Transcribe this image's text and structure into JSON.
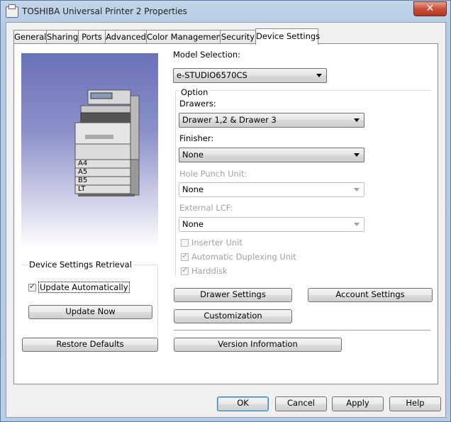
{
  "window": {
    "title": "TOSHIBA Universal Printer 2 Properties",
    "close_label": "✕"
  },
  "tabs": [
    {
      "label": "General"
    },
    {
      "label": "Sharing"
    },
    {
      "label": "Ports"
    },
    {
      "label": "Advanced"
    },
    {
      "label": "Color Management"
    },
    {
      "label": "Security"
    },
    {
      "label": "Device Settings"
    }
  ],
  "preview": {
    "tray_labels": [
      "A4",
      "A5",
      "B5",
      "LT"
    ]
  },
  "model": {
    "label": "Model Selection:",
    "value": "e-STUDIO6570CS"
  },
  "option": {
    "label": "Option",
    "drawers_label": "Drawers:",
    "drawers_value": "Drawer 1,2 & Drawer 3",
    "finisher_label": "Finisher:",
    "finisher_value": "None",
    "hole_punch_label": "Hole Punch Unit:",
    "hole_punch_value": "None",
    "external_lcf_label": "External LCF:",
    "external_lcf_value": "None",
    "inserter_label": "Inserter Unit",
    "inserter_checked": false,
    "duplex_label": "Automatic Duplexing Unit",
    "duplex_checked": true,
    "harddisk_label": "Harddisk",
    "harddisk_checked": true
  },
  "retrieval": {
    "label": "Device Settings Retrieval",
    "update_auto_label": "Update Automatically",
    "update_auto_checked": true,
    "update_now_label": "Update Now"
  },
  "buttons": {
    "restore_defaults": "Restore Defaults",
    "drawer_settings": "Drawer Settings",
    "account_settings": "Account Settings",
    "customization": "Customization",
    "version_information": "Version Information"
  },
  "footer": {
    "ok": "OK",
    "cancel": "Cancel",
    "apply": "Apply",
    "help": "Help"
  }
}
